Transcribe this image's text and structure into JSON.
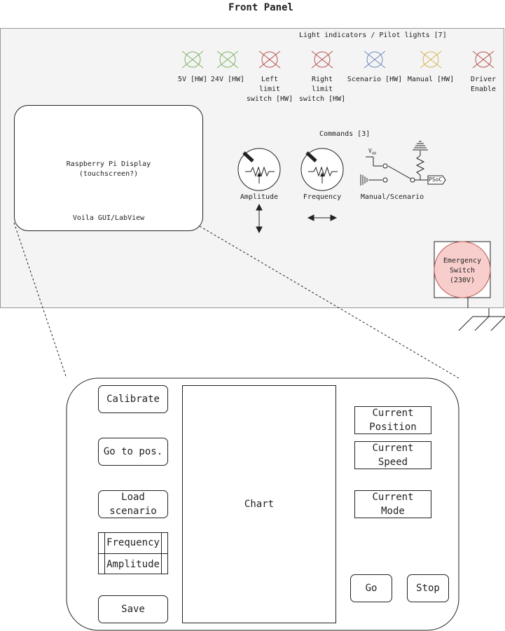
{
  "page_title": "Front Panel",
  "indicators": {
    "heading": "Light indicators / Pilot lights [7]",
    "lights": [
      {
        "label": "5V [HW]",
        "color": "#82b366"
      },
      {
        "label": "24V [HW]",
        "color": "#82b366"
      },
      {
        "label": "Left\nlimit\nswitch [HW]",
        "color": "#b85450"
      },
      {
        "label": "Right\nlimit\nswitch [HW]",
        "color": "#b85450"
      },
      {
        "label": "Scenario [HW]",
        "color": "#6c8ebf"
      },
      {
        "label": "Manual [HW]",
        "color": "#d6b656"
      },
      {
        "label": "Driver\nEnable",
        "color": "#b85450"
      }
    ]
  },
  "display": {
    "title": "Raspberry Pi Display\n(touchscreen?)",
    "subtitle": "Voila GUI/LabView"
  },
  "commands": {
    "heading": "Commands [3]",
    "amplitude_label": "Amplitude",
    "frequency_label": "Frequency",
    "switch_label": "Manual/Scenario",
    "vdd_label": "V",
    "vdd_sub": "dd",
    "psoc_label": "PSoC"
  },
  "emergency": {
    "label": "Emergency\nSwitch\n(230V)",
    "fill": "#f8cecc",
    "stroke": "#b85450"
  },
  "gui": {
    "calibrate": "Calibrate",
    "goto_pos": "Go to pos.",
    "load_scenario": "Load\nscenario",
    "frequency": "Frequency",
    "amplitude": "Amplitude",
    "save": "Save",
    "chart": "Chart",
    "current_position": "Current\nPosition",
    "current_speed": "Current\nSpeed",
    "current_mode": "Current\nMode",
    "go": "Go",
    "stop": "Stop"
  }
}
